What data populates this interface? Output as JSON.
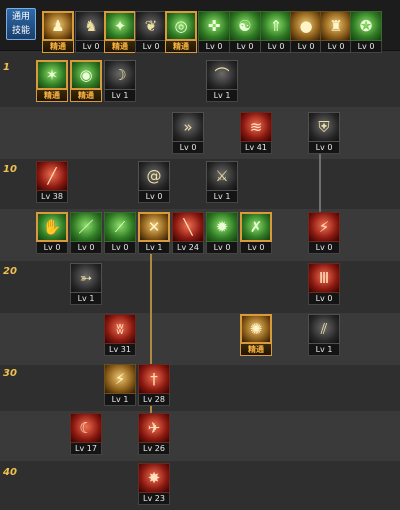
{
  "common_label": "通用 技能",
  "selected_text": "精通",
  "level_markers": [
    "1",
    "10",
    "20",
    "30",
    "40"
  ],
  "colors": {
    "connector_gold": "#b08840",
    "connector_grey": "#707070",
    "level_marker": "#f0c050",
    "selected_border": "#d89a3a"
  },
  "common_skills": [
    {
      "icon": "sitting-figure-icon",
      "level": "精通",
      "theme": "gold"
    },
    {
      "icon": "crouching-figure-icon",
      "level": "Lv 0",
      "theme": "dark"
    },
    {
      "icon": "running-figure-icon",
      "level": "精通",
      "theme": "green"
    },
    {
      "icon": "wings-icon",
      "level": "Lv 0",
      "theme": "dark"
    },
    {
      "icon": "target-icon",
      "level": "精通",
      "theme": "green"
    },
    {
      "icon": "crosshair-icon",
      "level": "Lv 0",
      "theme": "green"
    },
    {
      "icon": "meditating-figure-icon",
      "level": "Lv 0",
      "theme": "green"
    },
    {
      "icon": "rising-figure-icon",
      "level": "Lv 0",
      "theme": "green"
    },
    {
      "icon": "orb-icon",
      "level": "Lv 0",
      "theme": "gold"
    },
    {
      "icon": "armored-figure-icon",
      "level": "Lv 0",
      "theme": "gold"
    },
    {
      "icon": "power-figure-icon",
      "level": "Lv 0",
      "theme": "green"
    }
  ],
  "skills": [
    {
      "icon": "slash-burst-icon",
      "level": "精通",
      "theme": "green"
    },
    {
      "icon": "eye-icon",
      "level": "精通",
      "theme": "green"
    },
    {
      "icon": "arc-slash-icon",
      "level": "Lv 1",
      "theme": "dark"
    },
    {
      "icon": "curved-blade-icon",
      "level": "Lv 1",
      "theme": "dark"
    },
    {
      "icon": "triple-arrow-icon",
      "level": "Lv 0",
      "theme": "dark"
    },
    {
      "icon": "red-wave-icon",
      "level": "Lv 41",
      "theme": "red"
    },
    {
      "icon": "shield-icon",
      "level": "Lv 0",
      "theme": "dark"
    },
    {
      "icon": "red-slash-icon",
      "level": "Lv 38",
      "theme": "red"
    },
    {
      "icon": "spiral-icon",
      "level": "Lv 0",
      "theme": "dark"
    },
    {
      "icon": "leaping-figure-icon",
      "level": "Lv 1",
      "theme": "dark"
    },
    {
      "icon": "green-claw-icon",
      "level": "Lv 0",
      "theme": "green"
    },
    {
      "icon": "green-sword-icon",
      "level": "Lv 0",
      "theme": "green"
    },
    {
      "icon": "green-blade-icon",
      "level": "Lv 0",
      "theme": "green"
    },
    {
      "icon": "dual-blades-icon",
      "level": "Lv 1",
      "theme": "gold"
    },
    {
      "icon": "red-blade-icon",
      "level": "Lv 24",
      "theme": "red"
    },
    {
      "icon": "green-spark-icon",
      "level": "Lv 0",
      "theme": "green"
    },
    {
      "icon": "crossed-swords-icon",
      "level": "Lv 0",
      "theme": "green"
    },
    {
      "icon": "red-strike-icon",
      "level": "Lv 0",
      "theme": "red"
    },
    {
      "icon": "dash-slash-icon",
      "level": "Lv 1",
      "theme": "dark"
    },
    {
      "icon": "red-pillars-icon",
      "level": "Lv 0",
      "theme": "red"
    },
    {
      "icon": "red-claw-icon",
      "level": "Lv 31",
      "theme": "red"
    },
    {
      "icon": "gold-burst-icon",
      "level": "精通",
      "theme": "gold"
    },
    {
      "icon": "diagonal-slash-icon",
      "level": "Lv 1",
      "theme": "dark"
    },
    {
      "icon": "gold-streak-icon",
      "level": "Lv 1",
      "theme": "gold"
    },
    {
      "icon": "red-sword-icon",
      "level": "Lv 28",
      "theme": "red"
    },
    {
      "icon": "crescent-icon",
      "level": "Lv 17",
      "theme": "red"
    },
    {
      "icon": "red-phoenix-icon",
      "level": "Lv 26",
      "theme": "red"
    },
    {
      "icon": "red-explosion-icon",
      "level": "Lv 23",
      "theme": "red"
    }
  ]
}
